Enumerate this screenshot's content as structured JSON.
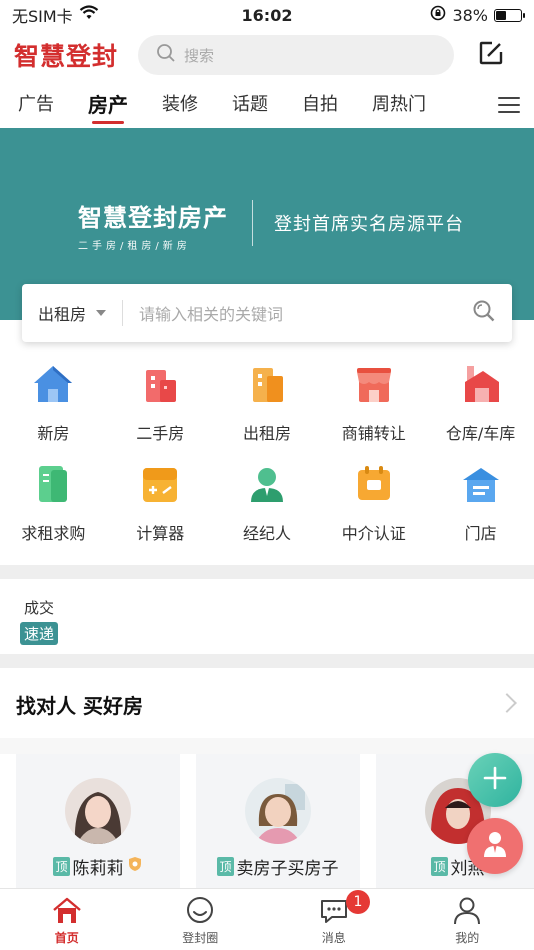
{
  "status_bar": {
    "carrier": "无SIM卡",
    "time": "16:02",
    "battery_pct": "38%",
    "battery_level": 0.38
  },
  "header": {
    "logo": "智慧登封",
    "search_placeholder": "搜索"
  },
  "tabs": [
    {
      "label": "广告",
      "active": false
    },
    {
      "label": "房产",
      "active": true
    },
    {
      "label": "装修",
      "active": false
    },
    {
      "label": "话题",
      "active": false
    },
    {
      "label": "自拍",
      "active": false
    },
    {
      "label": "周热门",
      "active": false
    }
  ],
  "banner": {
    "title": "智慧登封房产",
    "subtitle": "二手房/租房/新房",
    "slogan": "登封首席实名房源平台",
    "color": "#3c9293"
  },
  "search_card": {
    "select_value": "出租房",
    "placeholder": "请输入相关的关键词"
  },
  "categories": [
    {
      "label": "新房",
      "icon": "house-icon"
    },
    {
      "label": "二手房",
      "icon": "building-icon"
    },
    {
      "label": "出租房",
      "icon": "rental-building-icon"
    },
    {
      "label": "商铺转让",
      "icon": "shop-icon"
    },
    {
      "label": "仓库/车库",
      "icon": "warehouse-icon"
    },
    {
      "label": "求租求购",
      "icon": "document-icon"
    },
    {
      "label": "计算器",
      "icon": "calculator-icon"
    },
    {
      "label": "经纪人",
      "icon": "agent-icon"
    },
    {
      "label": "中介认证",
      "icon": "certificate-icon"
    },
    {
      "label": "门店",
      "icon": "store-icon"
    }
  ],
  "deal": {
    "line1": "成交",
    "line2": "速递"
  },
  "section": {
    "title": "找对人 买好房"
  },
  "agents": [
    {
      "tag": "顶",
      "name": "陈莉莉",
      "verified": true
    },
    {
      "tag": "顶",
      "name": "卖房子买房子",
      "verified": false
    },
    {
      "tag": "顶",
      "name": "刘燕",
      "verified": false
    }
  ],
  "bottom_nav": [
    {
      "label": "首页",
      "icon": "home-icon",
      "active": true
    },
    {
      "label": "登封圈",
      "icon": "circle-chat-icon",
      "active": false
    },
    {
      "label": "消息",
      "icon": "message-icon",
      "active": false
    },
    {
      "label": "我的",
      "icon": "user-icon",
      "active": false
    }
  ],
  "message_badge": "1",
  "colors": {
    "brand_red": "#d32e2e",
    "teal": "#3c9293"
  }
}
